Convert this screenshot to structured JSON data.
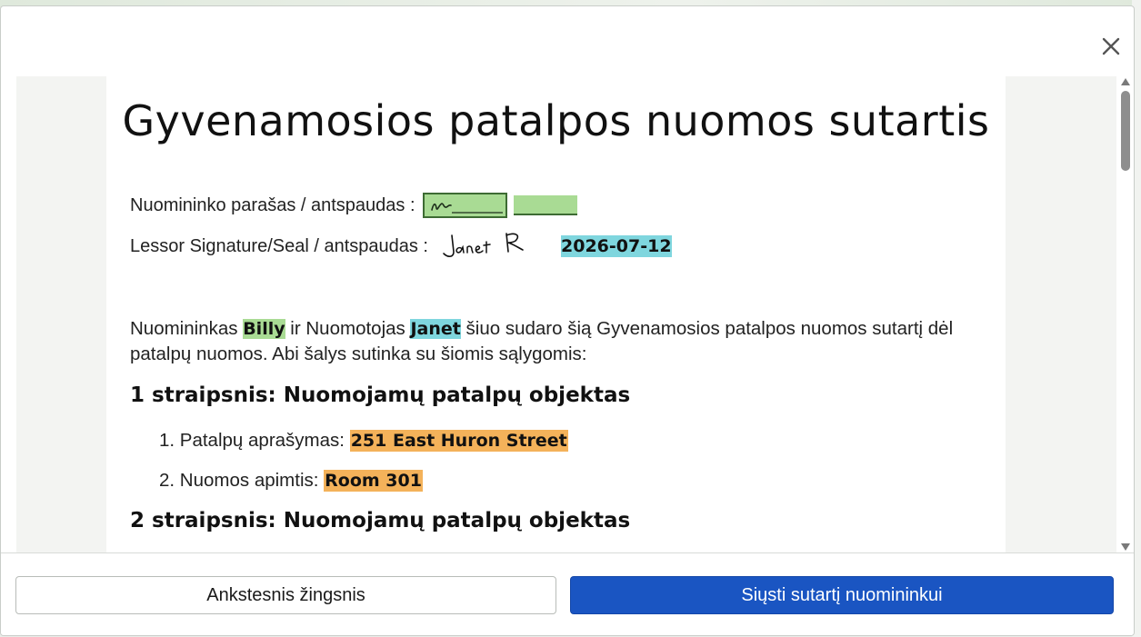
{
  "document": {
    "title": "Gyvenamosios patalpos nuomos sutartis",
    "signature_row_1": {
      "label": "Nuomininko parašas / antspaudas :"
    },
    "signature_row_2": {
      "label": "Lessor Signature/Seal / antspaudas :",
      "date": "2026-07-12"
    },
    "intro": {
      "part1": "Nuomininkas ",
      "tenant_name": "Billy",
      "part2": " ir Nuomotojas ",
      "lessor_name": "Janet",
      "part3": " šiuo sudaro šią Gyvenamosios patalpos nuomos sutartį dėl patalpų nuomos. Abi šalys sutinka su šiomis sąlygomis:"
    },
    "article1": {
      "heading": "1 straipsnis: Nuomojamų patalpų objektas",
      "item1_label": "1. Patalpų aprašymas:",
      "item1_value": "251 East Huron Street",
      "item2_label": "2. Nuomos apimtis:",
      "item2_value": "Room 301"
    },
    "article2": {
      "heading": "2 straipsnis: Nuomojamų patalpų objektas"
    }
  },
  "footer": {
    "back_label": "Ankstesnis žingsnis",
    "send_label": "Siųsti sutartį nuomininkui"
  },
  "colors": {
    "highlight_green": "#a9db94",
    "highlight_cyan": "#7fd6de",
    "highlight_orange": "#f4b25a",
    "primary_button": "#1a55c2"
  },
  "icons": {
    "close": "close-icon",
    "scroll_up": "scroll-up-arrow-icon",
    "scroll_down": "scroll-down-arrow-icon"
  }
}
